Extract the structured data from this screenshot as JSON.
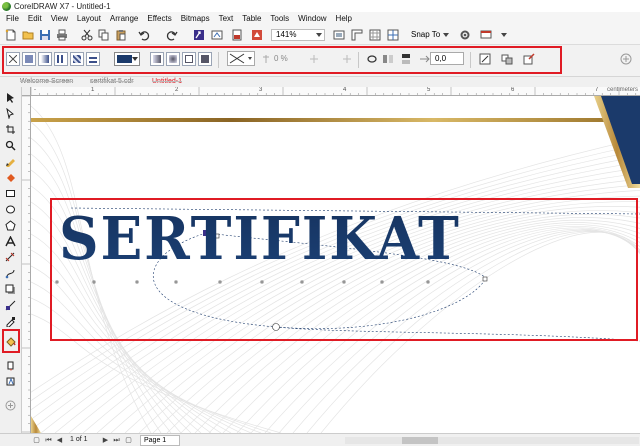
{
  "window": {
    "title": "CorelDRAW X7 - Untitled-1"
  },
  "menu": [
    "File",
    "Edit",
    "View",
    "Layout",
    "Arrange",
    "Effects",
    "Bitmaps",
    "Text",
    "Table",
    "Tools",
    "Window",
    "Help"
  ],
  "toolbar": {
    "zoom": "141%",
    "snap_to": "Snap To"
  },
  "property_bar": {
    "transparency_percent": "0 %",
    "angle": "0,0",
    "fill_color": "#1b3a6b"
  },
  "doc_tabs": [
    "Welcome Screen",
    "sertifikat 5.cdr",
    "Untitled-1"
  ],
  "rulers": {
    "unit": "centimeters",
    "top_ticks": [
      "-",
      "1",
      "2",
      "3",
      "4",
      "5",
      "6",
      "7"
    ]
  },
  "canvas": {
    "heading": "SERTIFIKAT",
    "heading_color": "#1b3a6b",
    "accent_gold": "#c9a24a"
  },
  "status": {
    "page_count": "1 of 1",
    "page_tab": "Page 1"
  },
  "highlight_color": "#e01b24"
}
